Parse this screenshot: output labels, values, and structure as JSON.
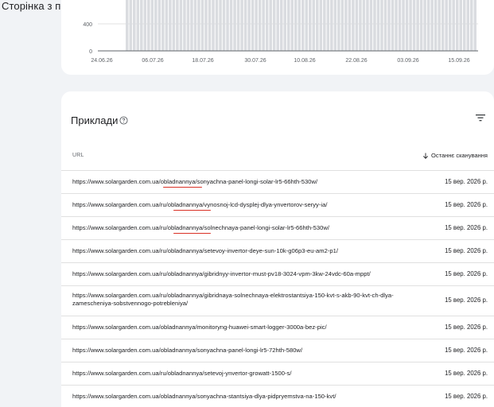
{
  "page": {
    "title": "Сторінка з переспрямуванням"
  },
  "chart_data": {
    "type": "bar",
    "y_ticks": [
      "400",
      "0"
    ],
    "x_ticks": [
      "24.06.26",
      "06.07.26",
      "18.07.26",
      "30.07.26",
      "10.08.26",
      "22.08.26",
      "03.09.26",
      "15.09.26"
    ],
    "bar_color": "#dadce0",
    "bar_count": 98,
    "bar_value_level": "above 400"
  },
  "examples": {
    "title": "Приклади",
    "help_icon": "help-circle-icon",
    "filter_icon": "filter-icon",
    "columns": {
      "url": "URL",
      "last_crawl": "Останнє сканування"
    },
    "rows": [
      {
        "url": "https://www.solargarden.com.ua/obladnannya/sonyachna-panel-longi-solar-lr5-66hth-530w/",
        "date": "15 вер. 2026 р."
      },
      {
        "url": "https://www.solargarden.com.ua/ru/obladnannya/vynosnoj-lcd-dysplej-dlya-ynvertorov-seryy-ia/",
        "date": "15 вер. 2026 р."
      },
      {
        "url": "https://www.solargarden.com.ua/ru/obladnannya/solnechnaya-panel-longi-solar-lr5-66hth-530w/",
        "date": "15 вер. 2026 р."
      },
      {
        "url": "https://www.solargarden.com.ua/ru/obladnannya/setevoy-invertor-deye-sun-10k-g06p3-eu-am2-p1/",
        "date": "15 вер. 2026 р."
      },
      {
        "url": "https://www.solargarden.com.ua/ru/obladnannya/gibridnyy-invertor-must-pv18-3024-vpm-3kw-24vdc-60a-mppt/",
        "date": "15 вер. 2026 р."
      },
      {
        "url": "https://www.solargarden.com.ua/ru/obladnannya/gibridnaya-solnechnaya-elektrostantsiya-150-kvt-s-akb-90-kvt-ch-dlya-zamescheniya-sobstvennogo-potrebleniya/",
        "date": "15 вер. 2026 р."
      },
      {
        "url": "https://www.solargarden.com.ua/obladnannya/monitoryng-huawei-smart-logger-3000a-bez-pic/",
        "date": "15 вер. 2026 р."
      },
      {
        "url": "https://www.solargarden.com.ua/obladnannya/sonyachna-panel-longi-lr5-72hth-580w/",
        "date": "15 вер. 2026 р."
      },
      {
        "url": "https://www.solargarden.com.ua/ru/obladnannya/setevoj-ynvertor-growatt-1500-s/",
        "date": "15 вер. 2026 р."
      },
      {
        "url": "https://www.solargarden.com.ua/obladnannya/sonyachna-stantsiya-dlya-pidpryemstva-na-150-kvt/",
        "date": "15 вер. 2026 р."
      }
    ]
  }
}
